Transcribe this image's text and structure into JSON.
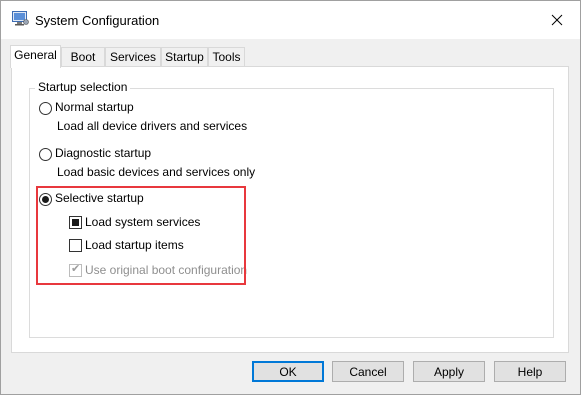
{
  "window": {
    "title": "System Configuration",
    "icon": "msconfig-icon",
    "close_glyph": "✕"
  },
  "tabs": [
    {
      "label": "General",
      "active": true
    },
    {
      "label": "Boot",
      "active": false
    },
    {
      "label": "Services",
      "active": false
    },
    {
      "label": "Startup",
      "active": false
    },
    {
      "label": "Tools",
      "active": false
    }
  ],
  "startup_selection": {
    "group_label": "Startup selection",
    "normal": {
      "label": "Normal startup",
      "description": "Load all device drivers and services",
      "selected": false
    },
    "diagnostic": {
      "label": "Diagnostic startup",
      "description": "Load basic devices and services only",
      "selected": false
    },
    "selective": {
      "label": "Selective startup",
      "selected": true,
      "options": [
        {
          "label": "Load system services",
          "state": "indeterminate",
          "enabled": true
        },
        {
          "label": "Load startup items",
          "state": "unchecked",
          "enabled": true
        },
        {
          "label": "Use original boot configuration",
          "state": "checked",
          "enabled": false
        }
      ]
    }
  },
  "buttons": {
    "ok": "OK",
    "cancel": "Cancel",
    "apply": "Apply",
    "help": "Help"
  },
  "colors": {
    "highlight": "#e8383d",
    "default_button_border": "#0078d7"
  }
}
